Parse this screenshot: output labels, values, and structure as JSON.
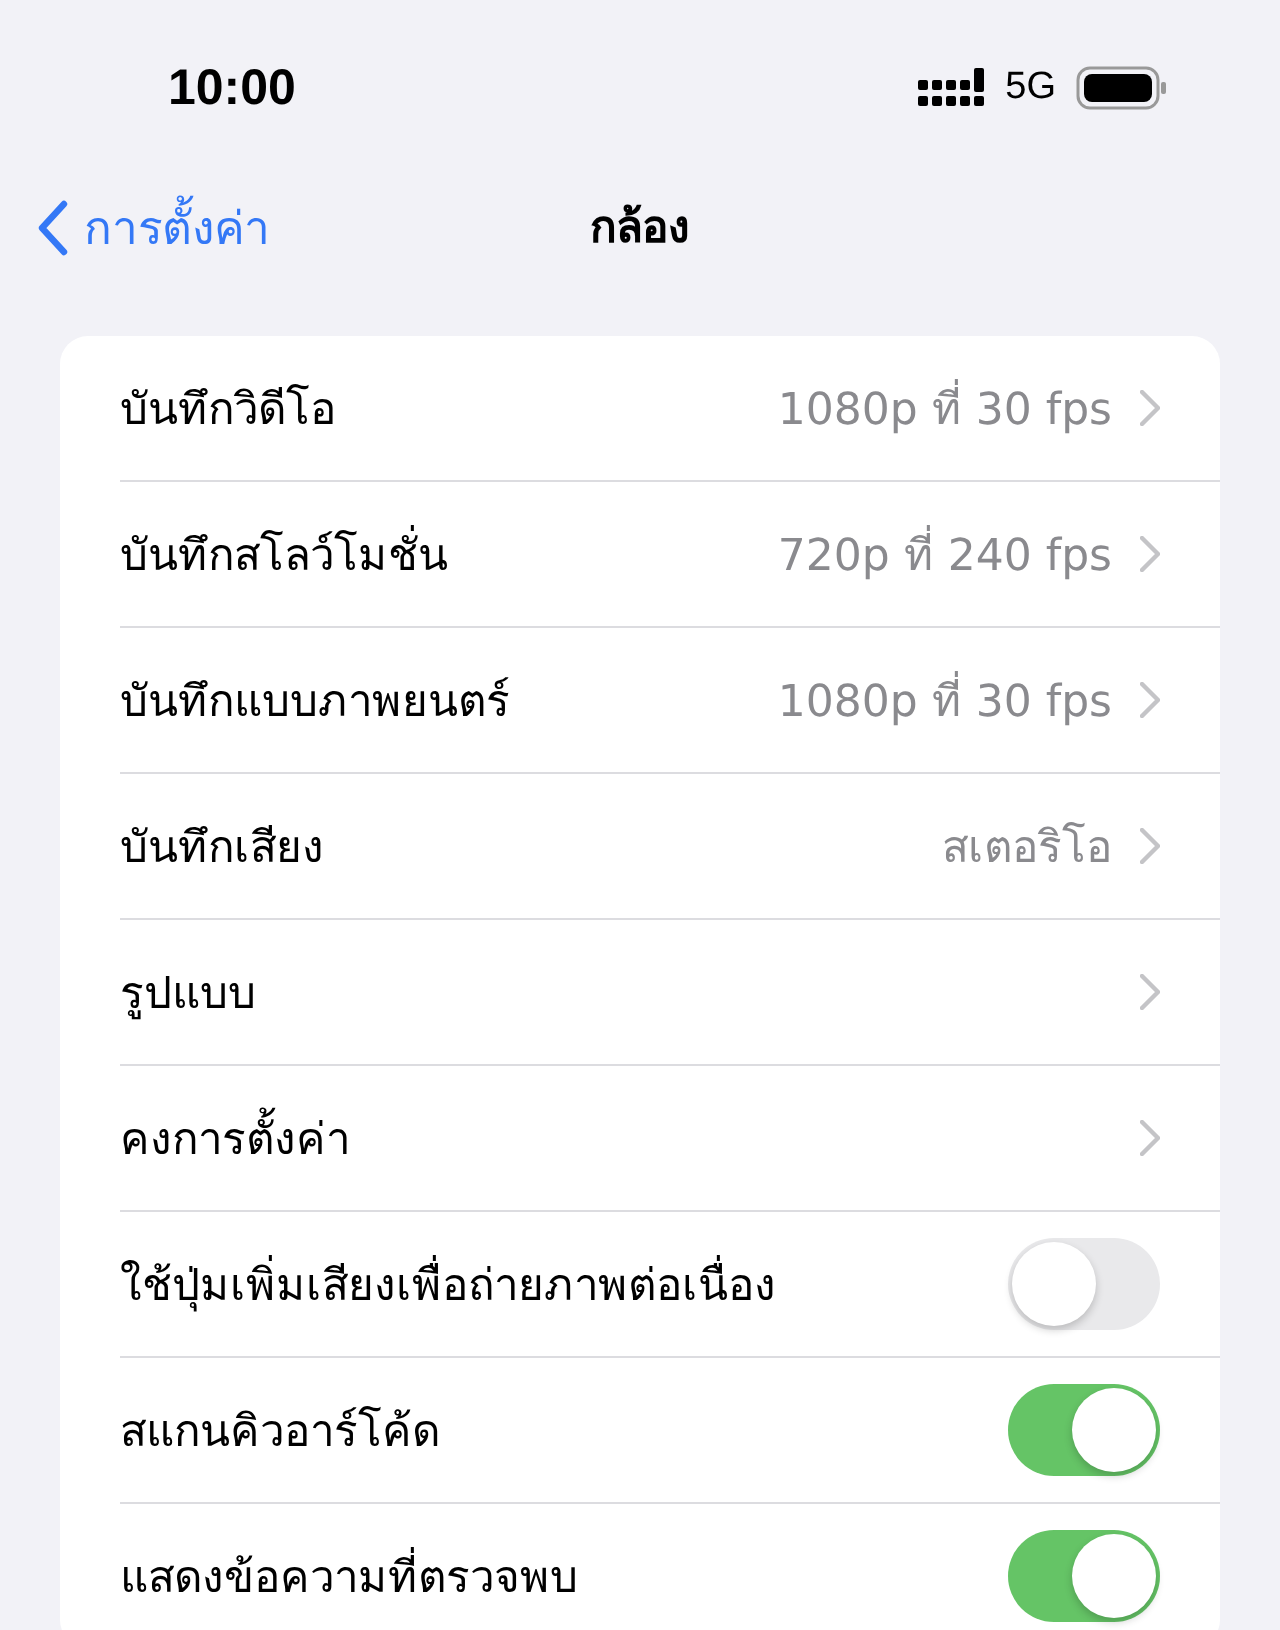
{
  "status_bar": {
    "time": "10:00",
    "network": "5G"
  },
  "nav": {
    "back": "การตั้งค่า",
    "title": "กล้อง"
  },
  "rows": [
    {
      "kind": "link",
      "label": "บันทึกวิดีโอ",
      "value": "1080p ที่ 30 fps"
    },
    {
      "kind": "link",
      "label": "บันทึกสโลว์โมชั่น",
      "value": "720p ที่ 240 fps"
    },
    {
      "kind": "link",
      "label": "บันทึกแบบภาพยนตร์",
      "value": "1080p ที่ 30 fps"
    },
    {
      "kind": "link",
      "label": "บันทึกเสียง",
      "value": "สเตอริโอ"
    },
    {
      "kind": "link",
      "label": "รูปแบบ"
    },
    {
      "kind": "link",
      "label": "คงการตั้งค่า"
    },
    {
      "kind": "toggle",
      "label": "ใช้ปุ่มเพิ่มเสียงเพื่อถ่ายภาพต่อเนื่อง",
      "on": false
    },
    {
      "kind": "toggle",
      "label": "สแกนคิวอาร์โค้ด",
      "on": true
    },
    {
      "kind": "toggle",
      "label": "แสดงข้อความที่ตรวจพบ",
      "on": true
    }
  ]
}
